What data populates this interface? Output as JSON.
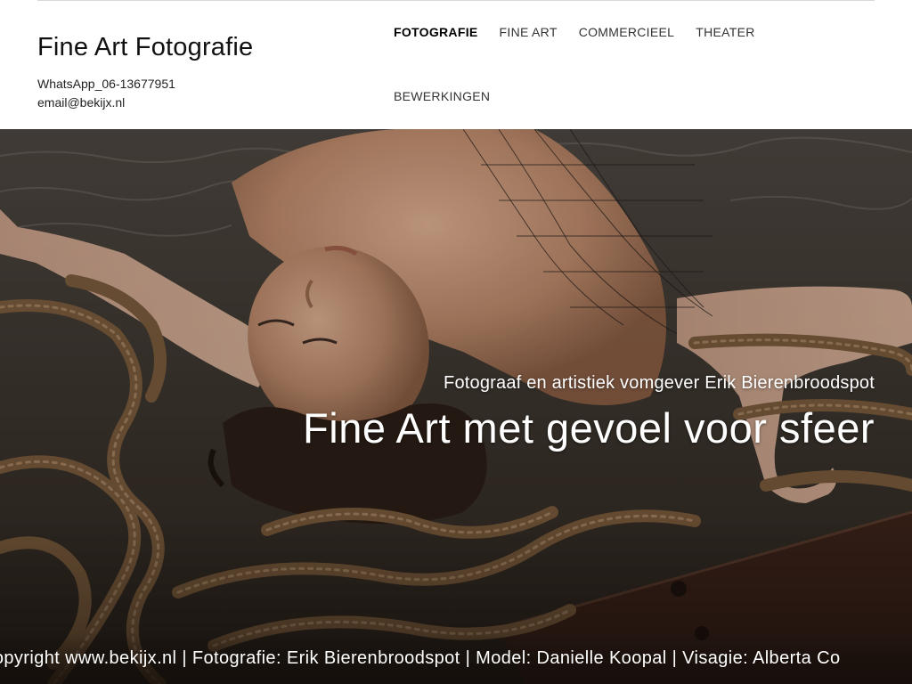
{
  "header": {
    "site_title": "Fine Art Fotografie",
    "contact_whatsapp": "WhatsApp_06-13677951",
    "contact_email": "email@bekijx.nl"
  },
  "nav": {
    "items": [
      {
        "label": "FOTOGRAFIE",
        "active": true
      },
      {
        "label": "FINE ART",
        "active": false
      },
      {
        "label": "COMMERCIEEL",
        "active": false
      },
      {
        "label": "THEATER",
        "active": false
      },
      {
        "label": "BEWERKINGEN",
        "active": false
      }
    ]
  },
  "hero": {
    "subtitle": "Fotograaf en artistiek vomgever Erik Bierenbroodspot",
    "title": "Fine Art met gevoel voor sfeer",
    "credit_line": "Copyright www.bekijx.nl | Fotografie: Erik Bierenbroodspot | Model: Danielle Koopal | Visagie: Alberta Co"
  },
  "colors": {
    "header_bg": "#ffffff",
    "title_text": "#111111",
    "nav_text": "#333333",
    "hero_text": "#ffffff",
    "hero_base": "#2b231e"
  }
}
